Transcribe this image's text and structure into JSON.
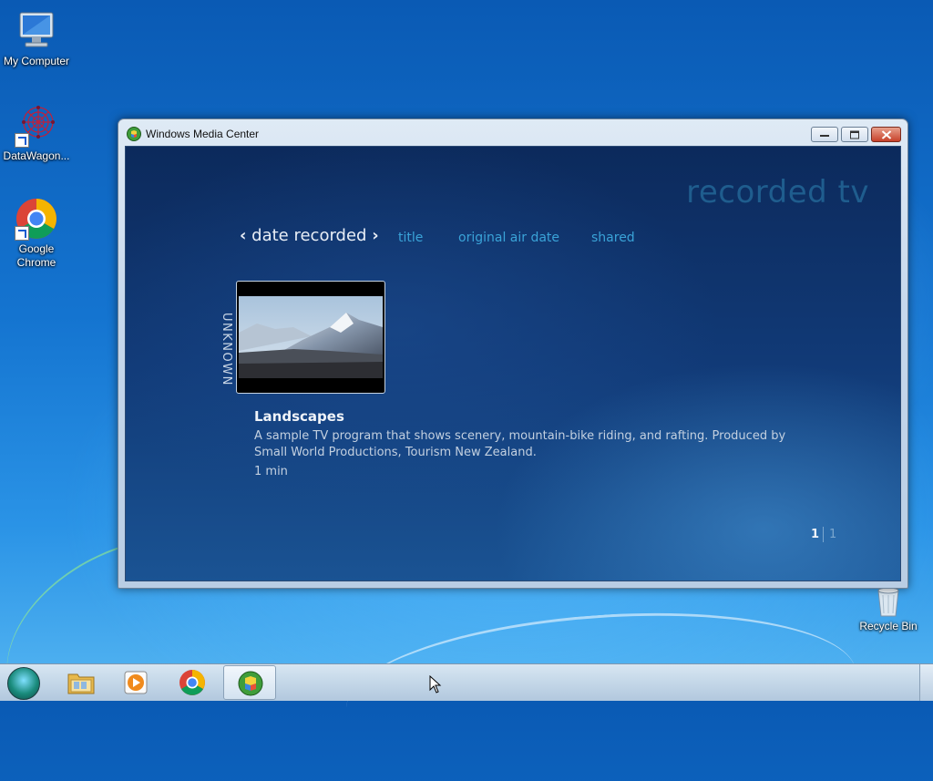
{
  "desktop": {
    "icons": [
      {
        "label": "My Computer",
        "icon": "computer-icon"
      },
      {
        "label": "DataWagon...",
        "icon": "datawagon-icon"
      },
      {
        "label": "Google\nChrome",
        "label_line1": "Google",
        "label_line2": "Chrome",
        "icon": "chrome-icon"
      },
      {
        "label": "Recycle Bin",
        "icon": "recycle-bin-icon"
      }
    ]
  },
  "window": {
    "title": "Windows Media Center",
    "controls": {
      "minimize": "minimize",
      "maximize": "maximize",
      "close": "close"
    }
  },
  "media_center": {
    "section_title": "recorded tv",
    "sort": {
      "active": "date recorded",
      "prev_glyph": "‹",
      "next_glyph": "›",
      "options": [
        "title",
        "original air date",
        "shared"
      ]
    },
    "group_label": "UNKNOWN",
    "recording": {
      "title": "Landscapes",
      "description": "A sample TV program that shows scenery, mountain-bike riding, and rafting. Produced by Small World Productions, Tourism New Zealand.",
      "duration": "1 min"
    },
    "pager": {
      "current": "1",
      "total": "1"
    }
  },
  "taskbar": {
    "items": [
      {
        "icon": "start-orb-icon"
      },
      {
        "icon": "file-explorer-icon"
      },
      {
        "icon": "media-player-icon"
      },
      {
        "icon": "chrome-icon"
      },
      {
        "icon": "media-center-icon",
        "active": true
      }
    ]
  },
  "colors": {
    "accent_text": "#3aa3d8",
    "section_title": "#1f5d8e",
    "content_bg": "#113a77"
  }
}
